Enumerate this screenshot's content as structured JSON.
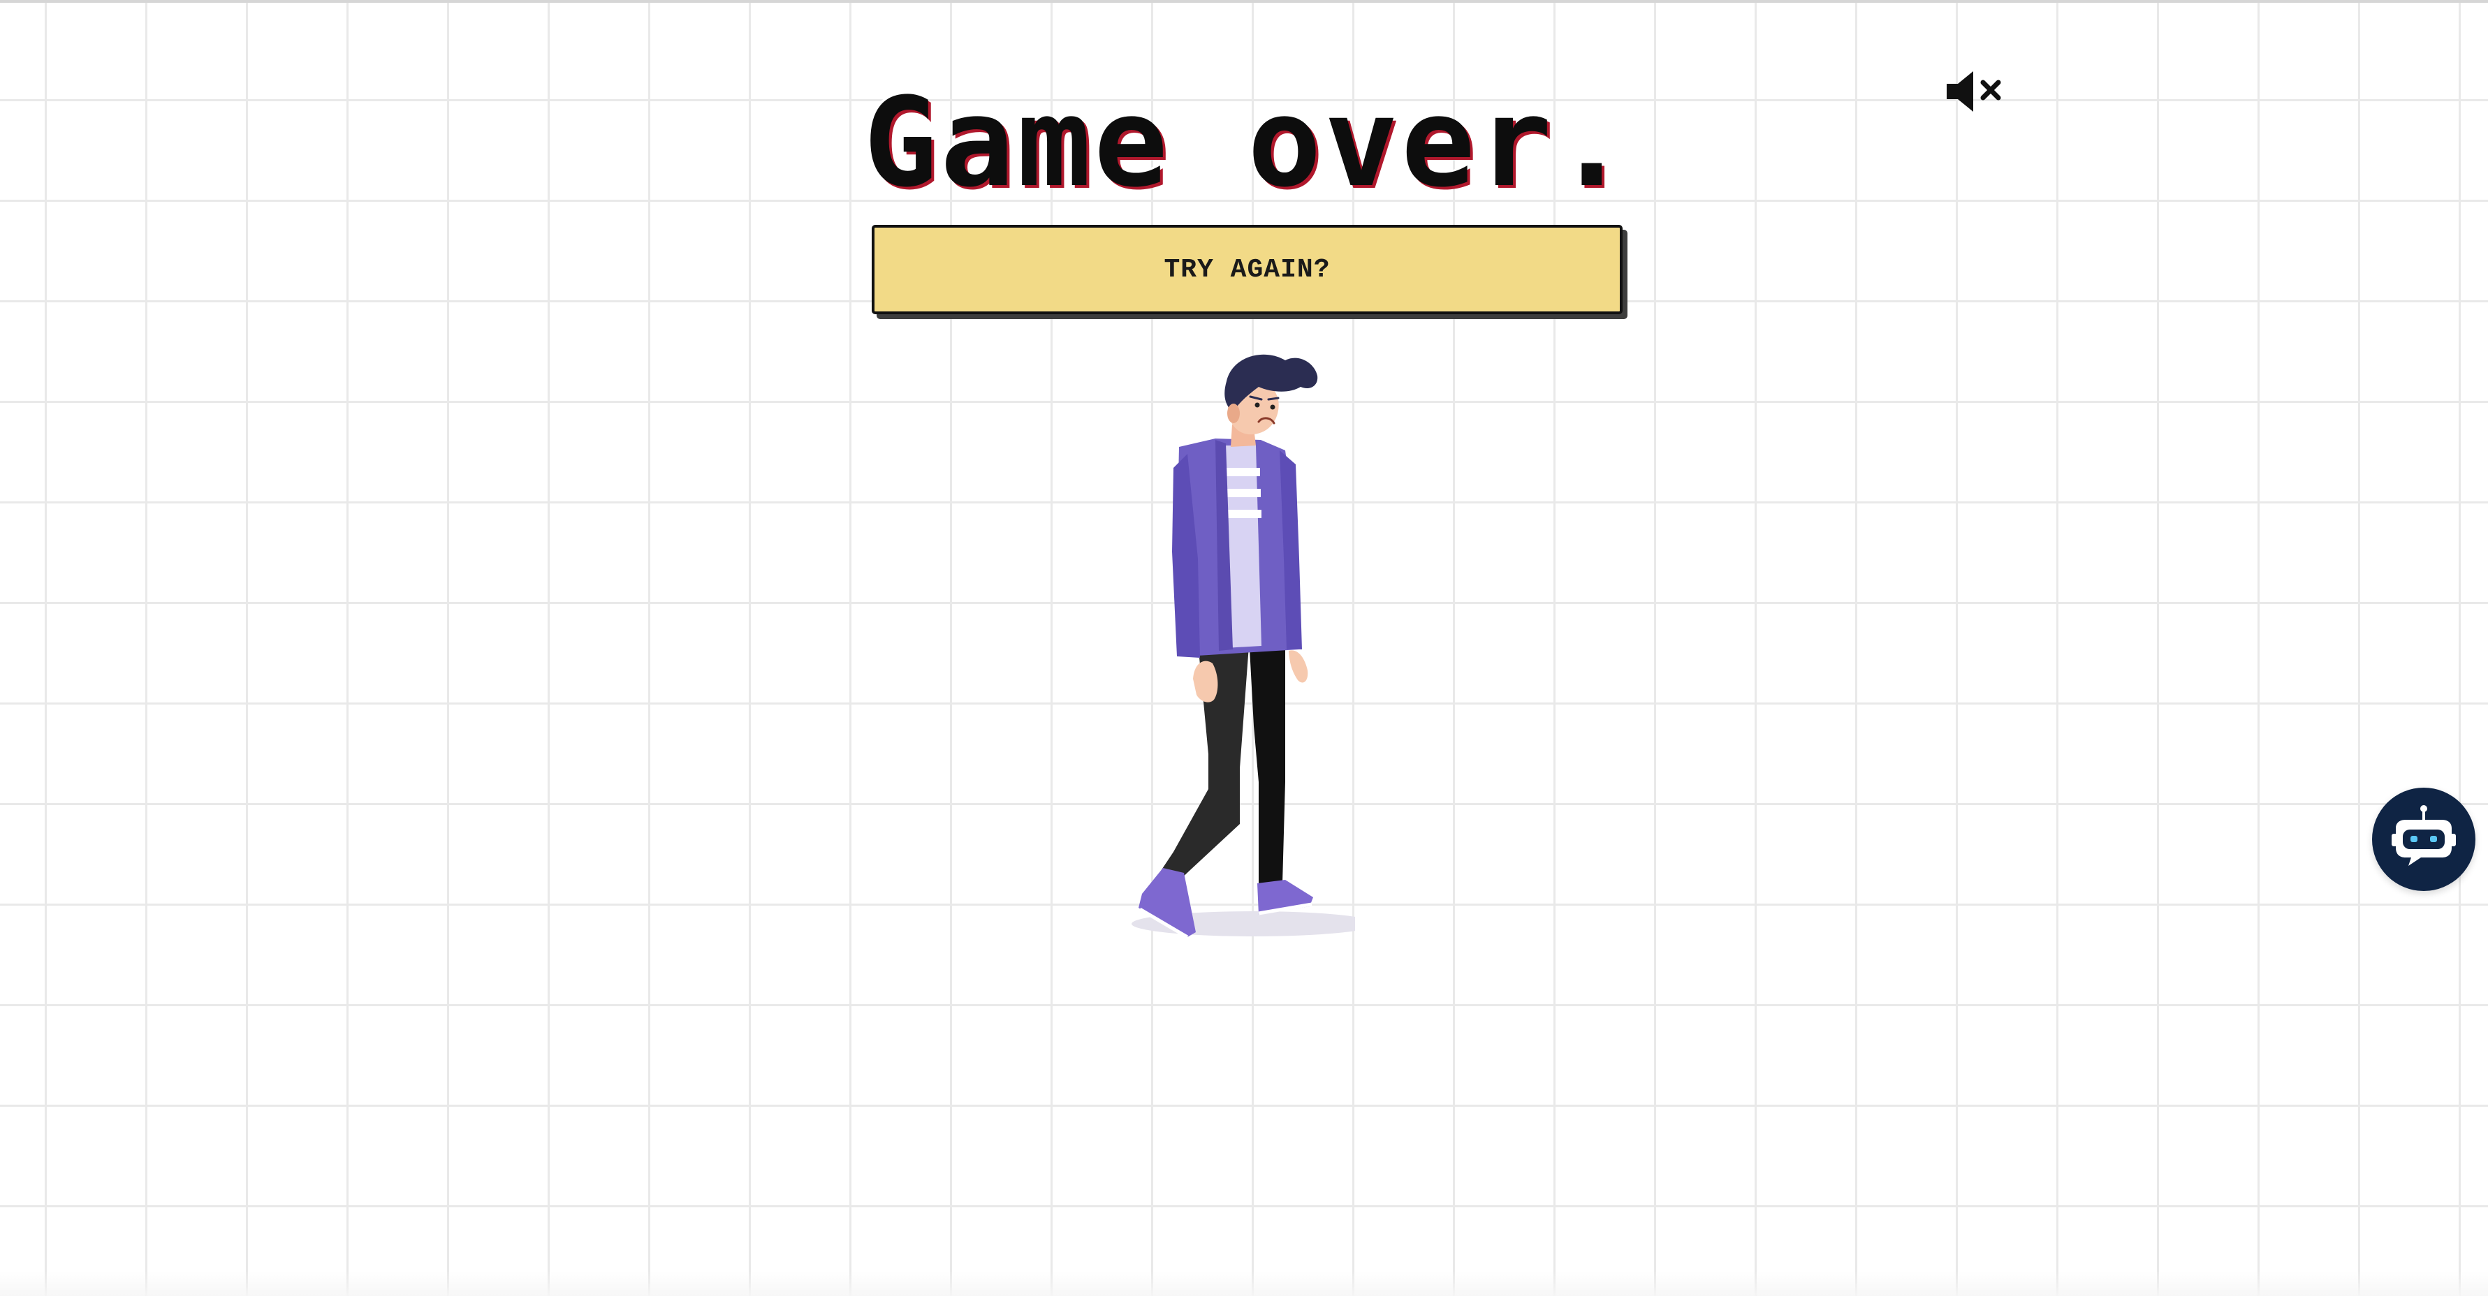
{
  "title": "Game over.",
  "try_again_label": "TRY AGAIN?",
  "icons": {
    "sound": "speaker-muted-icon",
    "chatbot": "robot-chat-icon"
  },
  "colors": {
    "button_fill": "#f2da87",
    "title_shadow": "#b0182c",
    "jacket": "#6f5fc4",
    "chatbot_bg": "#0f2444",
    "grid_line": "#e9e9e9"
  }
}
